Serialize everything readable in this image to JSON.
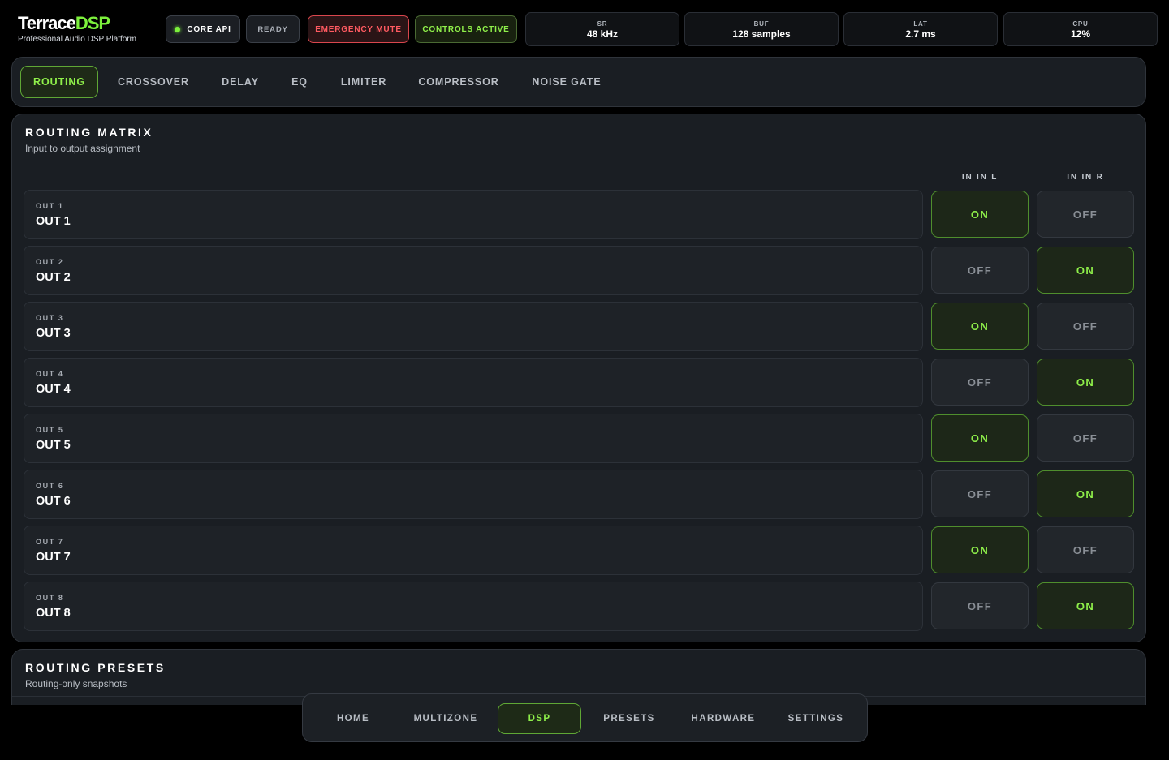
{
  "brand": {
    "name_main": "Terrace",
    "name_accent": "DSP",
    "subtitle": "Professional Audio DSP Platform"
  },
  "status": {
    "core_api": "CORE API",
    "ready": "READY",
    "emergency_mute": "EMERGENCY MUTE",
    "controls_active": "CONTROLS ACTIVE"
  },
  "stats": [
    {
      "key": "SR",
      "value": "48 kHz"
    },
    {
      "key": "BUF",
      "value": "128 samples"
    },
    {
      "key": "LAT",
      "value": "2.7 ms"
    },
    {
      "key": "CPU",
      "value": "12%"
    }
  ],
  "tabs": [
    "ROUTING",
    "CROSSOVER",
    "DELAY",
    "EQ",
    "LIMITER",
    "COMPRESSOR",
    "NOISE GATE"
  ],
  "active_tab": "ROUTING",
  "matrix": {
    "title": "ROUTING MATRIX",
    "subtitle": "Input to output assignment",
    "columns": [
      "IN IN L",
      "IN IN R"
    ],
    "rows": [
      {
        "tag": "OUT 1",
        "name": "OUT 1",
        "cells": [
          "ON",
          "OFF"
        ]
      },
      {
        "tag": "OUT 2",
        "name": "OUT 2",
        "cells": [
          "OFF",
          "ON"
        ]
      },
      {
        "tag": "OUT 3",
        "name": "OUT 3",
        "cells": [
          "ON",
          "OFF"
        ]
      },
      {
        "tag": "OUT 4",
        "name": "OUT 4",
        "cells": [
          "OFF",
          "ON"
        ]
      },
      {
        "tag": "OUT 5",
        "name": "OUT 5",
        "cells": [
          "ON",
          "OFF"
        ]
      },
      {
        "tag": "OUT 6",
        "name": "OUT 6",
        "cells": [
          "OFF",
          "ON"
        ]
      },
      {
        "tag": "OUT 7",
        "name": "OUT 7",
        "cells": [
          "ON",
          "OFF"
        ]
      },
      {
        "tag": "OUT 8",
        "name": "OUT 8",
        "cells": [
          "OFF",
          "ON"
        ]
      }
    ]
  },
  "presets": {
    "title": "ROUTING PRESETS",
    "subtitle": "Routing-only snapshots"
  },
  "nav": [
    "HOME",
    "MULTIZONE",
    "DSP",
    "PRESETS",
    "HARDWARE",
    "SETTINGS"
  ],
  "active_nav": "DSP",
  "colors": {
    "accent": "#7cf03c",
    "danger": "#ff5a61",
    "background": "#000000",
    "panel": "#1a1e23"
  }
}
